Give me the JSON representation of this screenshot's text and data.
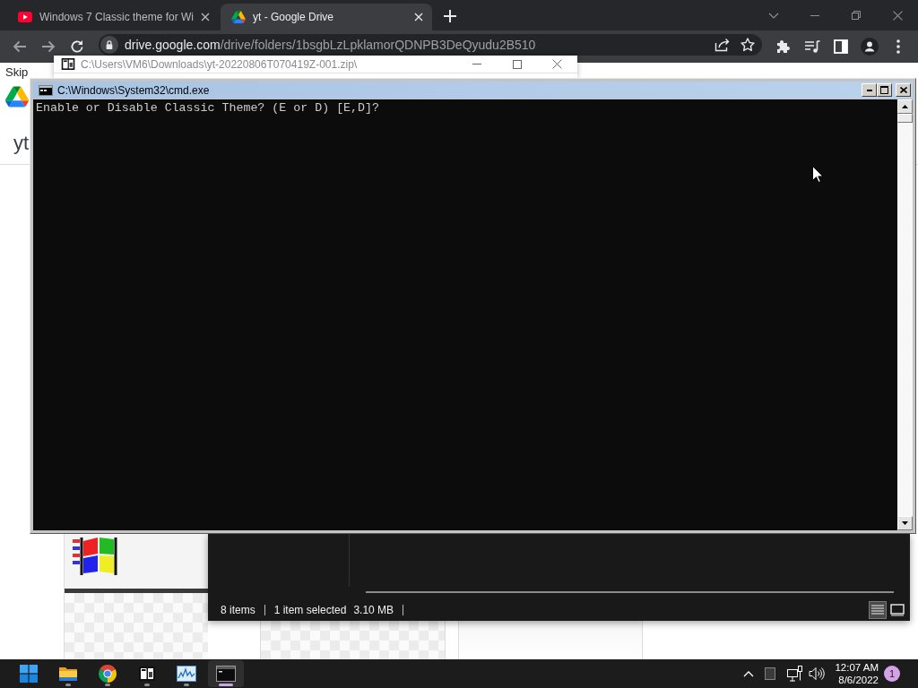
{
  "browser": {
    "tabs": [
      {
        "kind": "video",
        "title": "Windows 7 Classic theme for Wi",
        "selected": false
      },
      {
        "kind": "drive",
        "title": "yt - Google Drive",
        "selected": true
      }
    ],
    "address_bar": {
      "domain": "drive.google.com",
      "path": "/drive/folders/1bsgbLzLpklamorQDNPB3DeQyudu2B510"
    },
    "page": {
      "skip_link": "Skip",
      "folder_title": "yt"
    }
  },
  "archive_window": {
    "title": "C:\\Users\\VM6\\Downloads\\yt-20220806T070419Z-001.zip\\"
  },
  "explorer_window": {
    "status_bar": {
      "item_count": "8 items",
      "selection": "1 item selected",
      "selection_size": "3.10 MB"
    },
    "view_buttons": [
      {
        "kind": "details",
        "selected": true
      },
      {
        "kind": "large_icons",
        "selected": false
      }
    ]
  },
  "console_window": {
    "title": "C:\\Windows\\System32\\cmd.exe",
    "lines": [
      "Enable or Disable Classic Theme? (E or D) [E,D]?"
    ]
  },
  "taskbar": {
    "apps": [
      {
        "kind": "start",
        "running": false,
        "selected": false
      },
      {
        "kind": "files",
        "running": true,
        "selected": false
      },
      {
        "kind": "browser",
        "running": true,
        "selected": false
      },
      {
        "kind": "archiver",
        "running": true,
        "selected": false
      },
      {
        "kind": "monitor",
        "running": true,
        "selected": false
      },
      {
        "kind": "console",
        "running": true,
        "selected": true
      }
    ],
    "clock": {
      "time": "12:07 AM",
      "date": "8/6/2022"
    },
    "notification_count": "1"
  }
}
